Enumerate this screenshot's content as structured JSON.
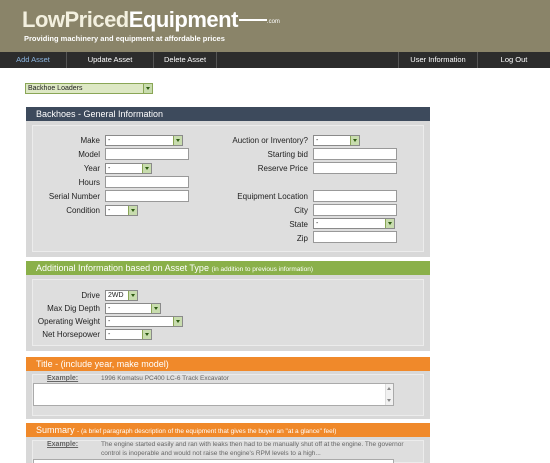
{
  "header": {
    "logo_low": "LowPriced",
    "logo_equipment": "Equipment",
    "logo_com": ".com",
    "tagline": "Providing machinery and equipment at affordable prices"
  },
  "nav": {
    "add_asset": "Add Asset",
    "update_asset": "Update Asset",
    "delete_asset": "Delete Asset",
    "user_information": "User Information",
    "log_out": "Log Out"
  },
  "category": {
    "selected": "Backhoe Loaders"
  },
  "general": {
    "title": "Backhoes - General Information",
    "make_label": "Make",
    "make_value": "-",
    "model_label": "Model",
    "year_label": "Year",
    "year_value": "-",
    "hours_label": "Hours",
    "serial_label": "Serial Number",
    "condition_label": "Condition",
    "condition_value": "-",
    "auction_label": "Auction or Inventory?",
    "auction_value": "-",
    "starting_bid_label": "Starting bid",
    "reserve_label": "Reserve Price",
    "location_label": "Equipment Location",
    "city_label": "City",
    "state_label": "State",
    "state_value": "-",
    "zip_label": "Zip"
  },
  "additional": {
    "title": "Additional Information based on Asset Type",
    "note": "(in addition to previous information)",
    "drive_label": "Drive",
    "drive_value": "2WD",
    "dig_label": "Max Dig Depth",
    "dig_value": "-",
    "weight_label": "Operating Weight",
    "weight_value": "-",
    "hp_label": "Net Horsepower",
    "hp_value": "-"
  },
  "title_section": {
    "title": "Title - (include year, make model)",
    "example_label": "Example:",
    "example_text": "1996 Komatsu PC400 LC-6 Track Excavator"
  },
  "summary_section": {
    "title": "Summary",
    "note": "- (a brief paragraph description of the equipment that gives the buyer an \"at a glance\" feel)",
    "example_label": "Example:",
    "example_text": "The engine started easily and ran with leaks then had to be manually shut off at the engine. The governor control is inoperable and would not raise the engine's RPM levels to a high..."
  },
  "colors": {
    "header_bg": "#8a8469",
    "nav_bg": "#2c2c2c",
    "section_general": "#3d4a5c",
    "section_additional": "#8ab04a",
    "section_title": "#f0892a",
    "section_summary": "#f0892a"
  }
}
